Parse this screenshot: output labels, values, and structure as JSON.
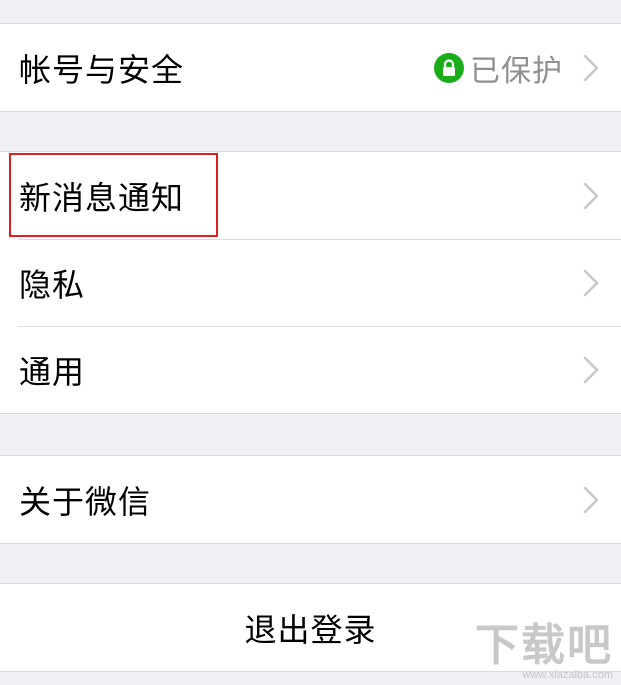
{
  "groups": [
    {
      "rows": [
        {
          "label": "帐号与安全",
          "value": "已保护",
          "icon": "lock-icon",
          "chevron": "chevron-right-icon"
        }
      ]
    },
    {
      "rows": [
        {
          "label": "新消息通知",
          "chevron": "chevron-right-icon"
        },
        {
          "label": "隐私",
          "chevron": "chevron-right-icon"
        },
        {
          "label": "通用",
          "chevron": "chevron-right-icon"
        }
      ]
    },
    {
      "rows": [
        {
          "label": "关于微信",
          "chevron": "chevron-right-icon"
        }
      ]
    }
  ],
  "logout": {
    "label": "退出登录"
  },
  "watermark": {
    "brand": "下载吧",
    "url": "www.xiazaiba.com"
  },
  "colors": {
    "background": "#efeff4",
    "cell": "#ffffff",
    "secondary_text": "#8e8e93",
    "chevron": "#c7c7cc",
    "lock_badge": "#1aad19",
    "highlight_box": "#e02020"
  }
}
